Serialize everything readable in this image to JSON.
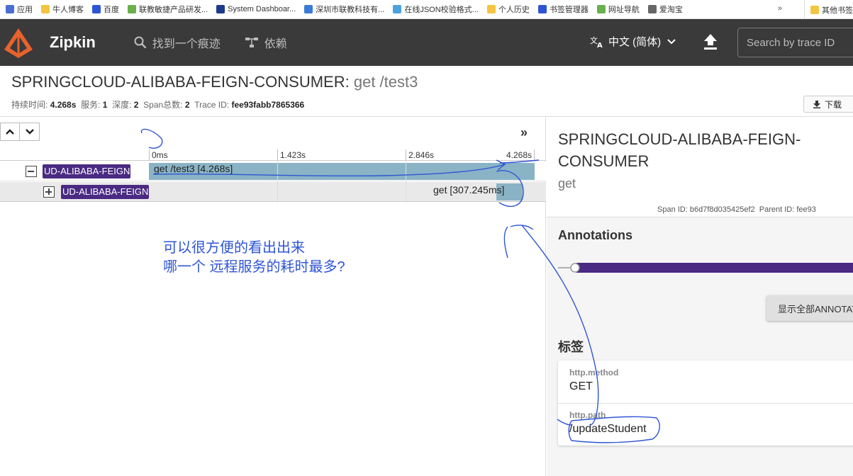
{
  "bookmarks": {
    "items": [
      {
        "label": "应用",
        "color": "#4a6fd1"
      },
      {
        "label": "牛人博客",
        "color": "#f4c542"
      },
      {
        "label": "百度",
        "color": "#2f55d4"
      },
      {
        "label": "联教敏捷产品研发...",
        "color": "#6ab04c"
      },
      {
        "label": "System Dashboar...",
        "color": "#1e3a8a"
      },
      {
        "label": "深圳市联教科技有...",
        "color": "#3a7bd5"
      },
      {
        "label": "在线JSON校验格式...",
        "color": "#4aa3df"
      },
      {
        "label": "个人历史",
        "color": "#f4c542"
      },
      {
        "label": "书签管理器",
        "color": "#2f55d4"
      },
      {
        "label": "网址导航",
        "color": "#6ab04c"
      },
      {
        "label": "爱淘宝",
        "color": "#666666"
      }
    ],
    "more": "»",
    "other": "其他书签"
  },
  "header": {
    "brand": "Zipkin",
    "nav": [
      {
        "label": "找到一个痕迹",
        "icon": "search-icon"
      },
      {
        "label": "依赖",
        "icon": "dependencies-icon"
      }
    ],
    "language": "中文 (简体)",
    "search_placeholder": "Search by trace ID"
  },
  "trace": {
    "service": "SPRINGCLOUD-ALIBABA-FEIGN-CONSUMER",
    "separator": ":",
    "span_name": " get /test3",
    "summary": {
      "duration_label": "持续时间:",
      "duration": "4.268s",
      "services_label": "服务:",
      "services": "1",
      "depth_label": "深度:",
      "depth": "2",
      "spans_label": "Span总数:",
      "spans": "2",
      "traceid_label": "Trace ID:",
      "traceid": "fee93fabb7865366"
    },
    "download": "下载"
  },
  "timeline": {
    "ticks": [
      "0ms",
      "1.423s",
      "2.846s",
      "4.268s"
    ],
    "rows": [
      {
        "service": "UD-ALIBABA-FEIGN",
        "label": "get /test3 [4.268s]"
      },
      {
        "service": "UD-ALIBABA-FEIGN",
        "label": "get [307.245ms]"
      }
    ],
    "note_line1": "可以很方便的看出出来",
    "note_line2": "哪一个 远程服务的耗时最多?"
  },
  "detail": {
    "service": "SPRINGCLOUD-ALIBABA-FEIGN-CONSUMER",
    "span_name": "get",
    "span_id_label": "Span ID:",
    "span_id": "b6d7f8d035425ef2",
    "parent_id_label": "Parent ID:",
    "parent_id": "fee93",
    "annotations_title": "Annotations",
    "show_all": "显示全部ANNOTATIONS",
    "tags_title": "标签",
    "tags": [
      {
        "key": "http.method",
        "value": "GET"
      },
      {
        "key": "http.path",
        "value": "/updateStudent"
      }
    ]
  },
  "colors": {
    "header_bg": "#3a3a3a",
    "service_label": "#4a2a82",
    "span_bar": "#8ab4c6",
    "annotation_line": "#4a2a82",
    "handwriting": "#2f55d4"
  }
}
